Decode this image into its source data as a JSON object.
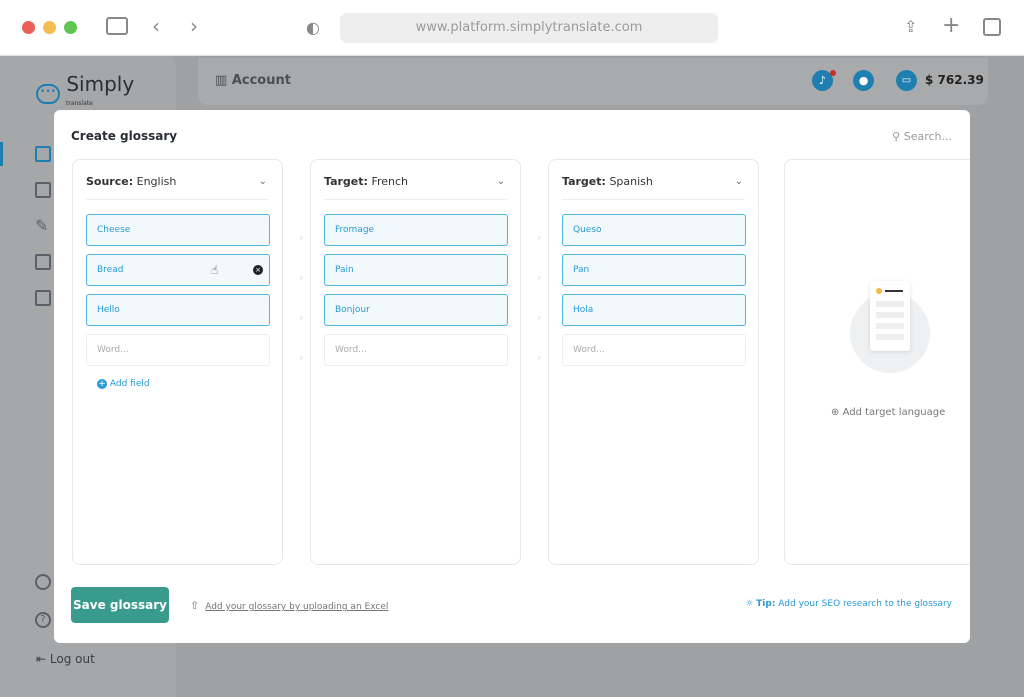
{
  "browser": {
    "url": "www.platform.simplytranslate.com"
  },
  "app": {
    "logo": "Simply",
    "logo_sub": "translate",
    "header_title": "Account",
    "balance": "$ 762.39",
    "logout": "Log out"
  },
  "modal": {
    "title": "Create glossary",
    "search_placeholder": "Search...",
    "columns": [
      {
        "label": "Source:",
        "lang": "English",
        "words": [
          "Cheese",
          "Bread",
          "Hello"
        ]
      },
      {
        "label": "Target:",
        "lang": "French",
        "words": [
          "Fromage",
          "Pain",
          "Bonjour"
        ]
      },
      {
        "label": "Target:",
        "lang": "Spanish",
        "words": [
          "Queso",
          "Pan",
          "Hola"
        ]
      }
    ],
    "word_placeholder": "Word...",
    "add_field": "Add field",
    "add_target": "Add target language",
    "save": "Save glossary",
    "upload": "Add your glossary by uploading an Excel",
    "tip_label": "Tip:",
    "tip": "Add your SEO research to the glossary"
  },
  "colors": {
    "accent": "#2a9ad2",
    "save": "#389b8d"
  }
}
